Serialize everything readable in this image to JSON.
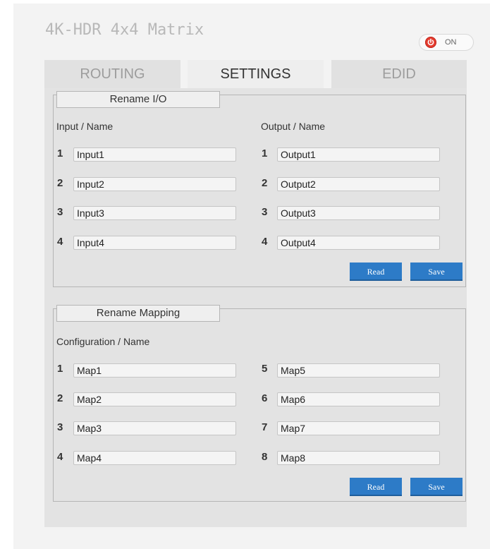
{
  "app": {
    "title": "4K-HDR 4x4 Matrix"
  },
  "power": {
    "label": "ON",
    "icon": "power-icon",
    "color": "#e43c2f"
  },
  "tabs": [
    {
      "label": "ROUTING",
      "active": false
    },
    {
      "label": "SETTINGS",
      "active": true
    },
    {
      "label": "EDID",
      "active": false
    }
  ],
  "rename_io": {
    "legend": "Rename I/O",
    "input_header": "Input / Name",
    "output_header": "Output / Name",
    "inputs": [
      {
        "num": "1",
        "value": "Input1"
      },
      {
        "num": "2",
        "value": "Input2"
      },
      {
        "num": "3",
        "value": "Input3"
      },
      {
        "num": "4",
        "value": "Input4"
      }
    ],
    "outputs": [
      {
        "num": "1",
        "value": "Output1"
      },
      {
        "num": "2",
        "value": "Output2"
      },
      {
        "num": "3",
        "value": "Output3"
      },
      {
        "num": "4",
        "value": "Output4"
      }
    ],
    "read_label": "Read",
    "save_label": "Save"
  },
  "rename_mapping": {
    "legend": "Rename Mapping",
    "header": "Configuration / Name",
    "maps_left": [
      {
        "num": "1",
        "value": "Map1"
      },
      {
        "num": "2",
        "value": "Map2"
      },
      {
        "num": "3",
        "value": "Map3"
      },
      {
        "num": "4",
        "value": "Map4"
      }
    ],
    "maps_right": [
      {
        "num": "5",
        "value": "Map5"
      },
      {
        "num": "6",
        "value": "Map6"
      },
      {
        "num": "7",
        "value": "Map7"
      },
      {
        "num": "8",
        "value": "Map8"
      }
    ],
    "read_label": "Read",
    "save_label": "Save"
  },
  "colors": {
    "accent": "#2d7bc7",
    "panel": "#e3e3e3"
  }
}
